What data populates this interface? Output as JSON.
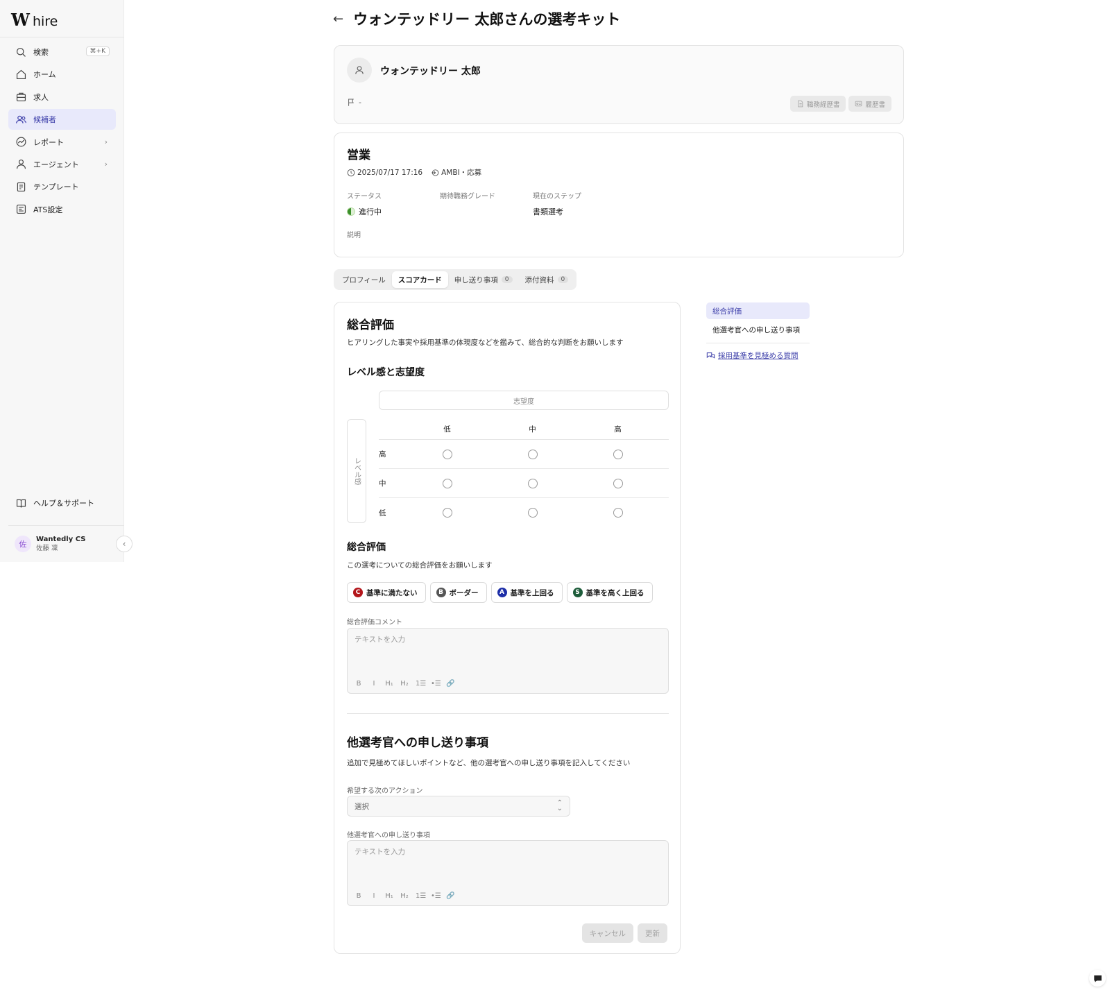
{
  "app": {
    "brand": "W",
    "name": "hire"
  },
  "sidebar": {
    "items": [
      {
        "label": "検索",
        "shortcut": "⌘+K",
        "icon": "search-icon"
      },
      {
        "label": "ホーム",
        "icon": "home-icon"
      },
      {
        "label": "求人",
        "icon": "briefcase-icon"
      },
      {
        "label": "候補者",
        "icon": "users-icon",
        "active": true
      },
      {
        "label": "レポート",
        "icon": "chart-icon"
      },
      {
        "label": "エージェント",
        "icon": "agent-icon"
      },
      {
        "label": "テンプレート",
        "icon": "template-icon"
      },
      {
        "label": "ATS設定",
        "icon": "settings-icon"
      }
    ],
    "help": "ヘルプ＆サポート",
    "account": {
      "initial": "佐",
      "org": "Wantedly CS",
      "user": "佐藤 凜"
    }
  },
  "header": {
    "title": "ウォンテッドリー 太郎さんの選考キット"
  },
  "candidate": {
    "name": "ウォンテッドリー 太郎",
    "flag_value": "-",
    "buttons": {
      "resume_work": "職務経歴書",
      "resume": "履歴書"
    }
  },
  "job": {
    "title": "営業",
    "datetime": "2025/07/17 17:16",
    "source": "AMBI・応募",
    "fields": {
      "status_label": "ステータス",
      "status_value": "進行中",
      "grade_label": "期待職務グレード",
      "grade_value": "",
      "step_label": "現在のステップ",
      "step_value": "書類選考"
    },
    "description_label": "説明"
  },
  "tabs": [
    {
      "label": "プロフィール"
    },
    {
      "label": "スコアカード",
      "active": true
    },
    {
      "label": "申し送り事項",
      "count": "0"
    },
    {
      "label": "添付資料",
      "count": "0"
    }
  ],
  "scorecard": {
    "overall_title": "総合評価",
    "overall_desc": "ヒアリングした事実や採用基準の体現度などを鑑みて、総合的な判断をお願いします",
    "level_title": "レベル感と志望度",
    "matrix": {
      "col_axis": "志望度",
      "row_axis": "レベル感",
      "cols": [
        "低",
        "中",
        "高"
      ],
      "rows": [
        "高",
        "中",
        "低"
      ]
    },
    "rating_title": "総合評価",
    "rating_desc": "この選考についての総合評価をお願いします",
    "grades": [
      {
        "letter": "C",
        "label": "基準に満たない",
        "color": "#b3161b"
      },
      {
        "letter": "B",
        "label": "ボーダー",
        "color": "#555555"
      },
      {
        "letter": "A",
        "label": "基準を上回る",
        "color": "#1e2fa8"
      },
      {
        "letter": "S",
        "label": "基準を高く上回る",
        "color": "#1d5c3a"
      }
    ],
    "comment_label": "総合評価コメント",
    "comment_placeholder": "テキストを入力",
    "handover_title": "他選考官への申し送り事項",
    "handover_desc": "追加で見極めてほしいポイントなど、他の選考官への申し送り事項を記入してください",
    "next_action_label": "希望する次のアクション",
    "next_action_value": "選択",
    "handover_label": "他選考官への申し送り事項",
    "handover_placeholder": "テキストを入力",
    "toolbar": [
      "B",
      "I",
      "H₁",
      "H₂",
      "1☰",
      "•☰",
      "🔗"
    ],
    "cancel": "キャンセル",
    "update": "更新"
  },
  "anchor_nav": {
    "items": [
      "総合評価",
      "他選考官への申し送り事項"
    ],
    "link": "採用基準を見極める質問"
  }
}
